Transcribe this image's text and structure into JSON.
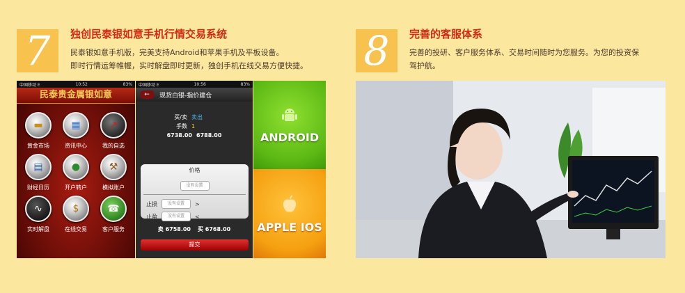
{
  "section7": {
    "number": "7",
    "title": "独创民泰银如意手机行情交易系统",
    "desc_line1": "民泰银如意手机版，完美支持Android和苹果手机及平板设备。",
    "desc_line2": "即时行情运筹帷幄，实时解盘即时更新，独创手机在线交易方便快捷。"
  },
  "section8": {
    "number": "8",
    "title": "完善的客服体系",
    "desc_line1": "完善的投研、客户服务体系、交易时间随时为您服务。为您的投资保",
    "desc_line2": "驾护航。"
  },
  "phone1": {
    "status_carrier": "中国移动 E",
    "status_time": "10:52",
    "status_battery": "83%",
    "title": "民泰贵金属银如意",
    "apps": [
      {
        "label": "黄金市场",
        "icon": "gold-bars-icon",
        "glyph": "▬"
      },
      {
        "label": "资讯中心",
        "icon": "news-icon",
        "glyph": "▦"
      },
      {
        "label": "我的自选",
        "icon": "chart-icon",
        "glyph": "↗"
      },
      {
        "label": "财经日历",
        "icon": "calendar-icon",
        "glyph": "▤"
      },
      {
        "label": "开户转户",
        "icon": "user-icon",
        "glyph": "●"
      },
      {
        "label": "模拟账户",
        "icon": "hammer-icon",
        "glyph": "⚒"
      },
      {
        "label": "实时解盘",
        "icon": "live-chart-icon",
        "glyph": "∿"
      },
      {
        "label": "在线交易",
        "icon": "money-bag-icon",
        "glyph": "$"
      },
      {
        "label": "客户服务",
        "icon": "phone-icon",
        "glyph": "☎"
      }
    ]
  },
  "phone2": {
    "status_carrier": "中国移动 E",
    "status_time": "10:56",
    "status_battery": "83%",
    "nav_title": "现货白银-指价建仓",
    "back_glyph": "←",
    "buysell_label": "买/卖",
    "buysell_value": "卖出",
    "qty_label": "手数",
    "qty_value": "1",
    "quote_left": "6738.00",
    "quote_right": "6788.00",
    "price_label": "价格",
    "not_set": "没有设置",
    "stoploss_label": "止损",
    "stoploss_sign": ">",
    "takeprofit_label": "止盈",
    "takeprofit_sign": "<",
    "sell_label": "卖",
    "sell_value": "6758.00",
    "buy_label": "买",
    "buy_value": "6768.00",
    "submit": "提交"
  },
  "tiles": {
    "android": "ANDROID",
    "ios": "APPLE IOS"
  },
  "colors": {
    "background": "#fce79f",
    "accent_red": "#d62a12",
    "number_box": "#f7c24d",
    "android_green": "#6cc21e",
    "ios_orange": "#f29b0c"
  }
}
